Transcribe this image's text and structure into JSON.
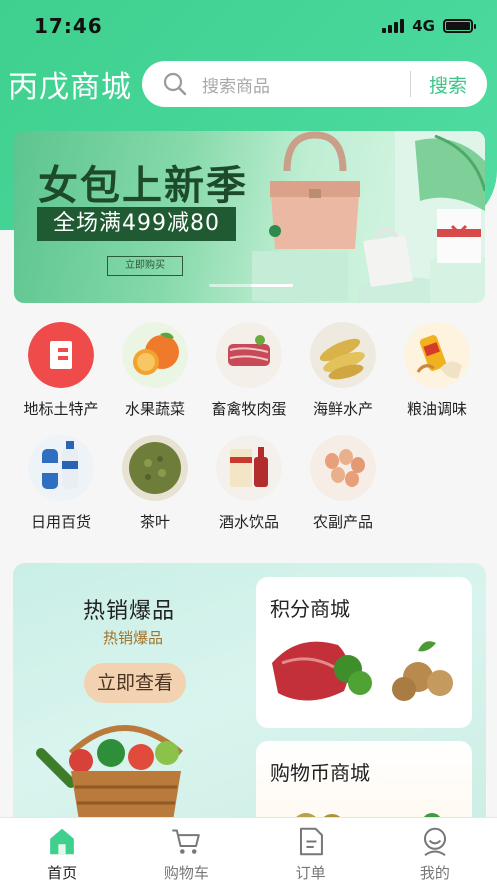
{
  "status": {
    "time": "17:46",
    "network": "4G"
  },
  "header": {
    "title": "丙戊商城"
  },
  "search": {
    "placeholder": "搜索商品",
    "button_label": "搜索"
  },
  "banner": {
    "headline": "女包上新季",
    "promo": "全场满499减80",
    "cta": "立即购买"
  },
  "categories": [
    {
      "label": "地标土特产",
      "icon": "landmark-building-icon"
    },
    {
      "label": "水果蔬菜",
      "icon": "fruit-icon"
    },
    {
      "label": "畜禽牧肉蛋",
      "icon": "meat-icon"
    },
    {
      "label": "海鲜水产",
      "icon": "fish-icon"
    },
    {
      "label": "粮油调味",
      "icon": "oil-grain-icon"
    },
    {
      "label": "日用百货",
      "icon": "shampoo-icon"
    },
    {
      "label": "茶叶",
      "icon": "tea-icon"
    },
    {
      "label": "酒水饮品",
      "icon": "liquor-icon"
    },
    {
      "label": "农副产品",
      "icon": "eggs-icon"
    }
  ],
  "promo": {
    "hot_title": "热销爆品",
    "hot_subtitle": "热销爆品",
    "hot_button": "立即查看",
    "points_mall": "积分商城",
    "coin_mall": "购物币商城"
  },
  "tabbar": [
    {
      "label": "首页",
      "icon": "home-icon",
      "active": true
    },
    {
      "label": "购物车",
      "icon": "cart-icon",
      "active": false
    },
    {
      "label": "订单",
      "icon": "order-doc-icon",
      "active": false
    },
    {
      "label": "我的",
      "icon": "profile-icon",
      "active": false
    }
  ],
  "colors": {
    "brand_green": "#3fcf8e",
    "search_accent": "#3ec489",
    "hot_button": "#f2d2b0"
  }
}
